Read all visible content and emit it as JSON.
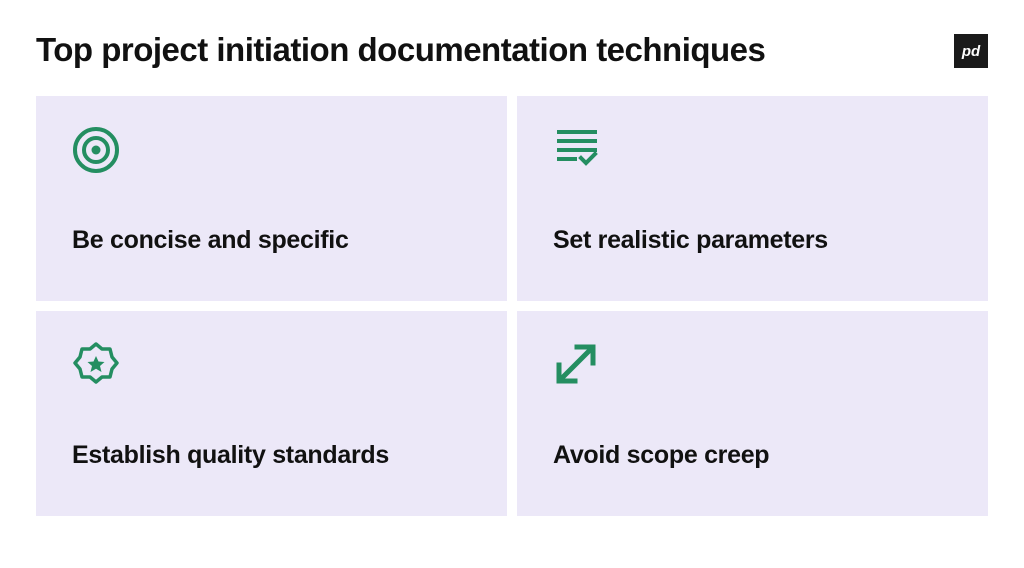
{
  "title": "Top project initiation documentation techniques",
  "logo": "pd",
  "colors": {
    "card_bg": "#ece8f8",
    "icon": "#248e61",
    "text": "#111111",
    "logo_bg": "#1a1a1a"
  },
  "cards": [
    {
      "icon": "target-icon",
      "label": "Be concise and specific"
    },
    {
      "icon": "checklist-icon",
      "label": "Set realistic parameters"
    },
    {
      "icon": "star-badge-icon",
      "label": "Establish quality standards"
    },
    {
      "icon": "expand-arrow-icon",
      "label": "Avoid scope creep"
    }
  ]
}
